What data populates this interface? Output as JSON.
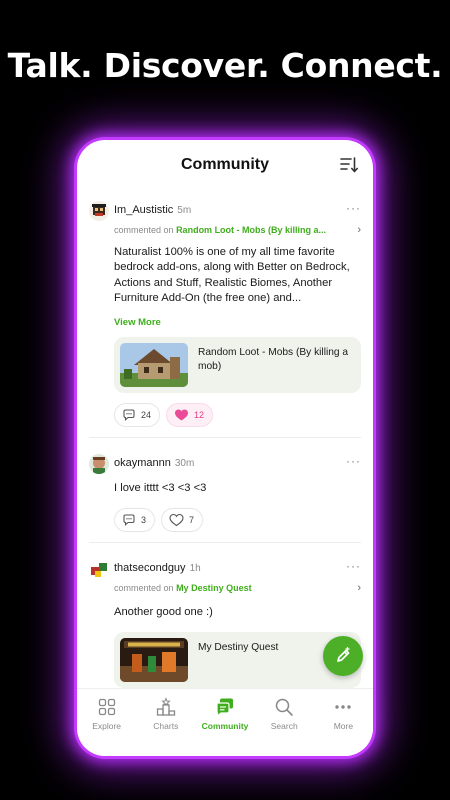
{
  "headline": "Talk. Discover. Connect.",
  "colors": {
    "accent": "#3fae1c",
    "glow": "#b02cf0",
    "like": "#e23c86"
  },
  "header": {
    "title": "Community",
    "sort_icon": "sort-icon"
  },
  "posts": [
    {
      "username": "Im_Austistic",
      "time": "5m",
      "commented_prefix": "commented on",
      "commented_link": "Random Loot - Mobs (By killing a...",
      "text": "Naturalist 100% is one of my all time favorite bedrock add-ons, along with Better on Bedrock, Actions and Stuff, Realistic Biomes, Another Furniture Add-On (the free one) and...",
      "view_more": "View More",
      "card_title": "Random Loot - Mobs (By killing a mob)",
      "comments": "24",
      "likes": "12"
    },
    {
      "username": "okaymannn",
      "time": "30m",
      "text": "I love itttt <3 <3 <3",
      "comments": "3",
      "likes": "7"
    },
    {
      "username": "thatsecondguy",
      "time": "1h",
      "commented_prefix": "commented on",
      "commented_link": "My Destiny Quest",
      "text": "Another good one :)",
      "card_title": "My Destiny Quest"
    }
  ],
  "tabs": [
    {
      "label": "Explore",
      "icon": "grid-icon"
    },
    {
      "label": "Charts",
      "icon": "podium-icon"
    },
    {
      "label": "Community",
      "icon": "chat-icon",
      "active": true
    },
    {
      "label": "Search",
      "icon": "search-icon"
    },
    {
      "label": "More",
      "icon": "dots-icon"
    }
  ]
}
